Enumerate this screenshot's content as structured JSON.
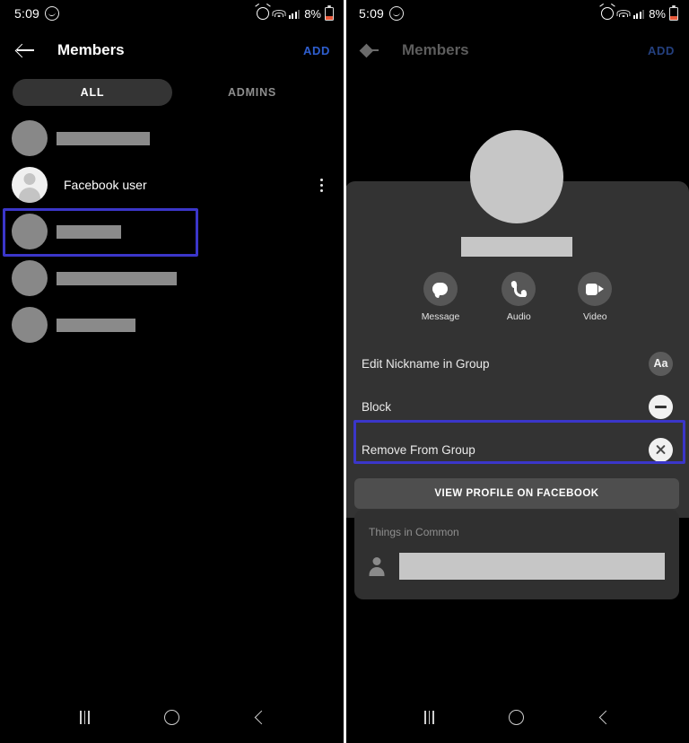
{
  "status_bar": {
    "time": "5:09",
    "messenger_badge_icon": "messenger-badge-icon",
    "alarm_icon": "alarm-icon",
    "wifi_icon": "wifi-icon",
    "signal_icon": "signal-bars-icon",
    "battery_percent": "8%",
    "battery_icon": "battery-low-icon"
  },
  "left_panel": {
    "app_bar": {
      "back_icon": "back-arrow-icon",
      "title": "Members",
      "add_label": "ADD"
    },
    "tabs": [
      {
        "label": "ALL",
        "active": true
      },
      {
        "label": "ADMINS",
        "active": false
      }
    ],
    "members": [
      {
        "name": "",
        "redacted": true,
        "redact_width": 104,
        "avatar": "generic",
        "menu": false,
        "highlighted": false
      },
      {
        "name": "Facebook user",
        "redacted": false,
        "redact_width": 0,
        "avatar": "facebook-user",
        "menu": true,
        "highlighted": false
      },
      {
        "name": "",
        "redacted": true,
        "redact_width": 72,
        "avatar": "generic",
        "menu": false,
        "highlighted": true
      },
      {
        "name": "",
        "redacted": true,
        "redact_width": 134,
        "avatar": "generic",
        "menu": false,
        "highlighted": false
      },
      {
        "name": "",
        "redacted": true,
        "redact_width": 88,
        "avatar": "generic",
        "menu": false,
        "highlighted": false
      }
    ],
    "highlight_color": "#3b36c9"
  },
  "right_panel": {
    "app_bar": {
      "back_icon": "back-arrow-icon",
      "title": "Members",
      "add_label": "ADD"
    },
    "profile_sheet": {
      "avatar": "profile-avatar",
      "name_redacted": true,
      "actions": [
        {
          "label": "Message",
          "icon": "chat-bubble-icon"
        },
        {
          "label": "Audio",
          "icon": "phone-icon"
        },
        {
          "label": "Video",
          "icon": "video-camera-icon"
        }
      ],
      "menu_items": [
        {
          "label": "Edit Nickname in Group",
          "icon": "text-format-aa-icon",
          "icon_text": "Aa",
          "highlighted": false
        },
        {
          "label": "Block",
          "icon": "block-minus-icon",
          "icon_text": "",
          "highlighted": false
        },
        {
          "label": "Remove From Group",
          "icon": "remove-x-icon",
          "icon_text": "",
          "highlighted": true
        }
      ],
      "view_profile_label": "VIEW PROFILE ON FACEBOOK"
    },
    "things_in_common": {
      "title": "Things in Common",
      "item_icon": "person-icon",
      "item_redacted": true
    },
    "highlight_color": "#3b36c9"
  },
  "nav_bar": {
    "recents_icon": "recents-icon",
    "home_icon": "home-icon",
    "back_icon": "nav-back-icon"
  }
}
